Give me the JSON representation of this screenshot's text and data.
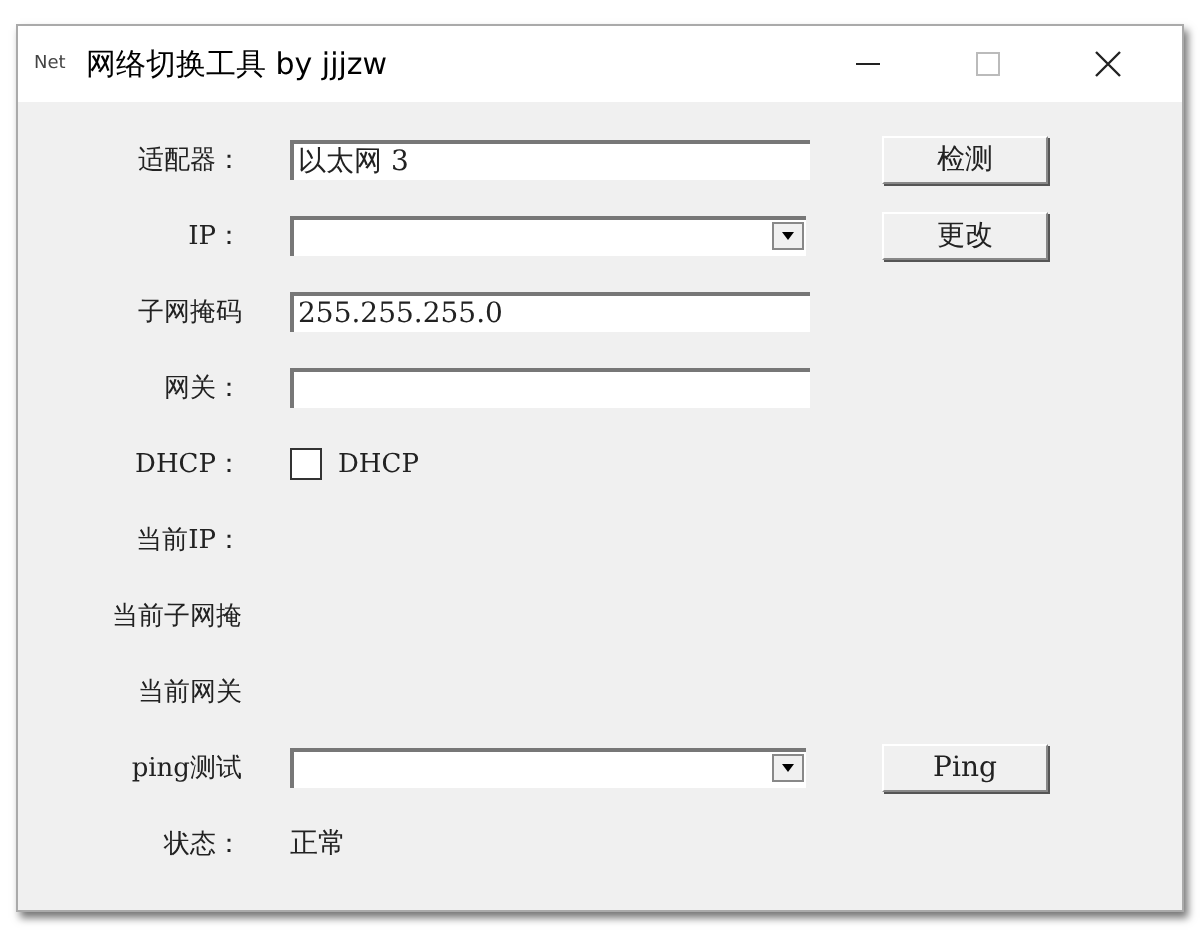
{
  "window": {
    "icon_label": "Net",
    "title": "网络切换工具 by jjjzw"
  },
  "rows": [
    {
      "kind": "text",
      "label": "适配器：",
      "value": "以太网 3",
      "button": "检测"
    },
    {
      "kind": "combo",
      "label": "IP：",
      "button": "更改"
    },
    {
      "kind": "text",
      "label": "子网掩码",
      "value": "255.255.255.0"
    },
    {
      "kind": "text",
      "label": "网关："
    },
    {
      "kind": "checkbox",
      "label": "DHCP：",
      "check_label": "DHCP",
      "checked": false
    },
    {
      "kind": "info",
      "label": "当前IP："
    },
    {
      "kind": "info",
      "label": "当前子网掩"
    },
    {
      "kind": "info",
      "label": "当前网关"
    },
    {
      "kind": "combo",
      "label": "ping测试",
      "button": "Ping"
    },
    {
      "kind": "info",
      "label": "状态：",
      "value": "正常"
    }
  ]
}
